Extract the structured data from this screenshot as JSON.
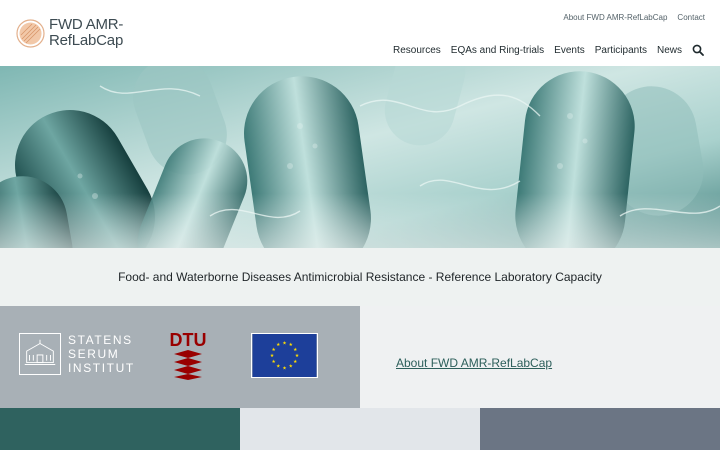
{
  "brand": {
    "line1": "FWD AMR-",
    "line2": "RefLabCap"
  },
  "top_links": [
    "About FWD AMR-RefLabCap",
    "Contact"
  ],
  "nav": {
    "items": [
      "Resources",
      "EQAs and Ring-trials",
      "Events",
      "Participants",
      "News"
    ],
    "search_icon": "search-icon"
  },
  "tagline": "Food- and Waterborne Diseases Antimicrobial Resistance - Reference Laboratory Capacity",
  "partners": {
    "ssi": [
      "STATENS",
      "SERUM",
      "INSTITUT"
    ],
    "dtu": "DTU",
    "eu_icon": "eu-flag-icon"
  },
  "about_link": "About FWD AMR-RefLabCap",
  "colors": {
    "accent": "#2f625f",
    "partner_band": "#a8b0b6",
    "dtu_red": "#990000",
    "eu_blue": "#1d3f9a"
  }
}
